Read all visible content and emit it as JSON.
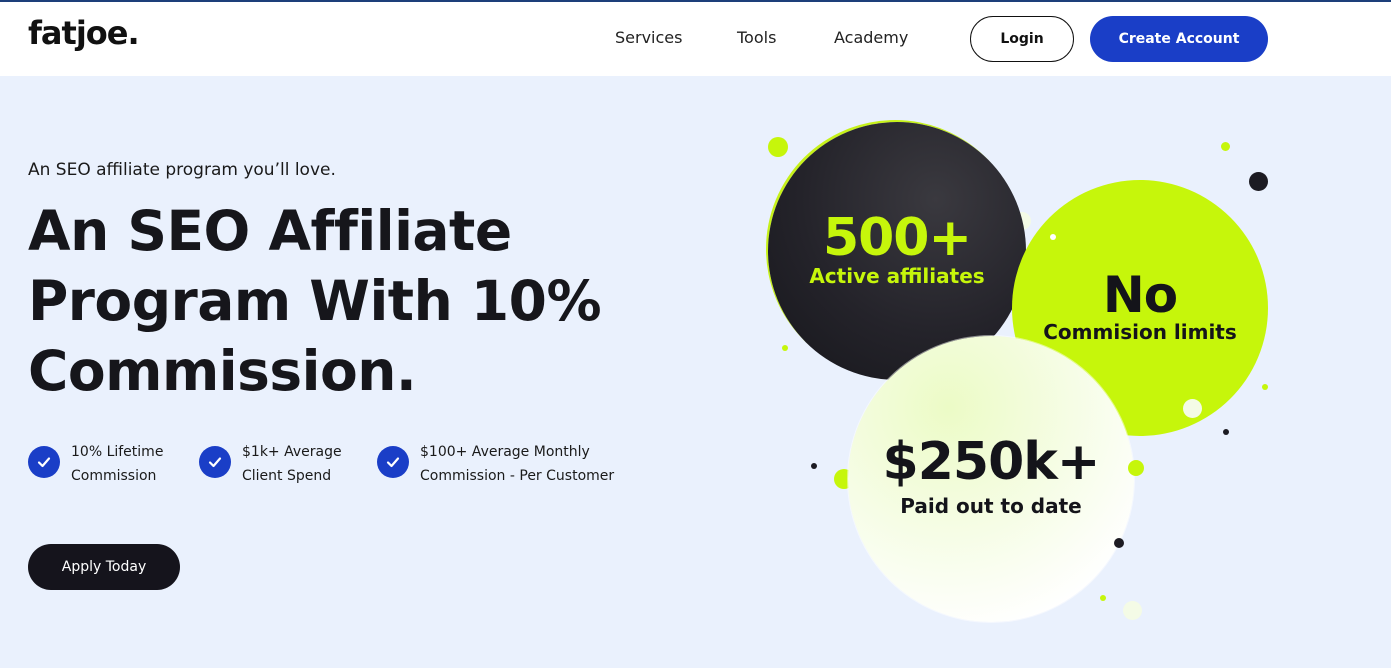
{
  "header": {
    "logo": "fatjoe.",
    "nav": [
      "Services",
      "Tools",
      "Academy"
    ],
    "login_label": "Login",
    "create_label": "Create Account"
  },
  "hero": {
    "eyebrow": "An SEO affiliate program you’ll love.",
    "headline_lines": [
      "An SEO Affiliate",
      "Program With 10%",
      "Commission."
    ],
    "features": [
      {
        "line1": "10% Lifetime",
        "line2": "Commission"
      },
      {
        "line1": "$1k+ Average",
        "line2": "Client Spend"
      },
      {
        "line1": "$100+ Average Monthly",
        "line2": "Commission - Per Customer"
      }
    ],
    "apply_label": "Apply Today"
  },
  "stats": [
    {
      "big": "500+",
      "small": "Active affiliates"
    },
    {
      "big": "No",
      "small": "Commision limits"
    },
    {
      "big": "$250k+",
      "small": "Paid out to date"
    }
  ],
  "icons": {
    "check": "check-icon"
  },
  "colors": {
    "accent_blue": "#1a3ec7",
    "lime": "#c6f60b",
    "dark": "#16161b",
    "background": "#eaf1fd"
  }
}
